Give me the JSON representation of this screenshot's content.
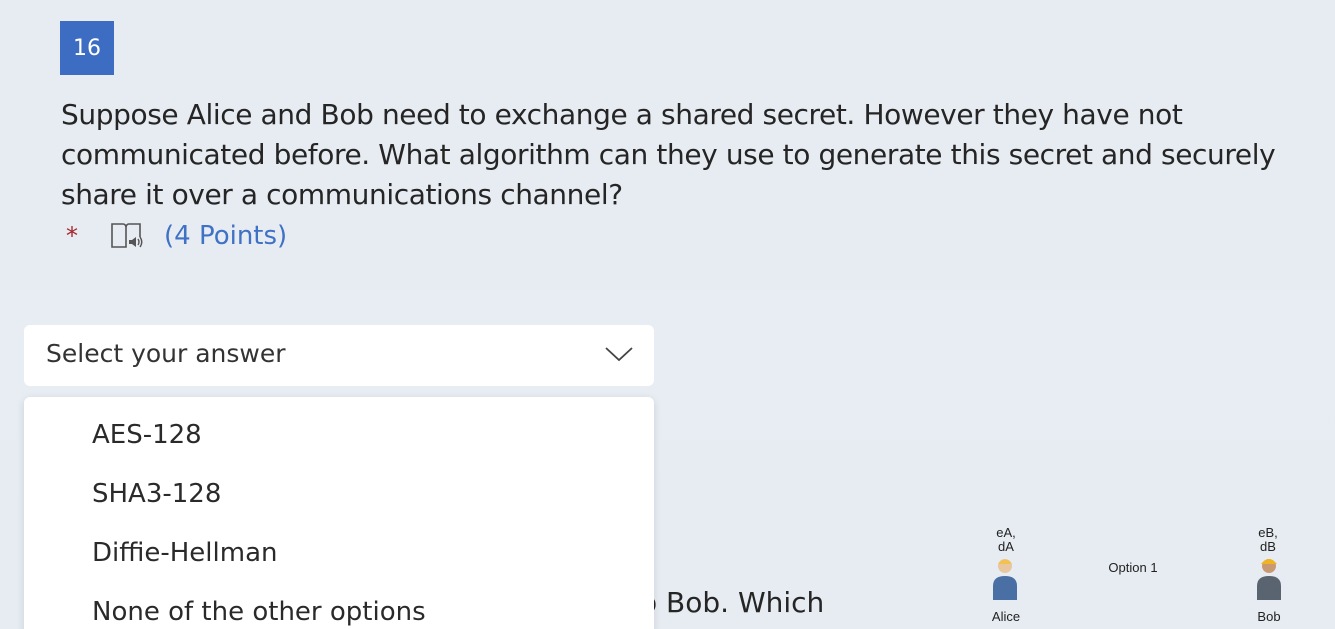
{
  "question": {
    "number": "16",
    "text": "Suppose Alice and Bob need to exchange a shared secret. However they have not communicated before. What algorithm can they use to generate this secret and securely share it over a communications channel?",
    "required_marker": "*",
    "points": "(4 Points)",
    "reader_icon": "immersive-reader-icon"
  },
  "answer_select": {
    "placeholder": "Select your answer",
    "expanded": true,
    "options": [
      "AES-128",
      "SHA3-128",
      "Diffie-Hellman",
      "None of the other options"
    ]
  },
  "next_question": {
    "partial_text": "o Bob. Which",
    "diagram": {
      "alice_keys_line1": "eA,",
      "alice_keys_line2": "dA",
      "bob_keys_line1": "eB,",
      "bob_keys_line2": "dB",
      "option_label": "Option 1",
      "alice_name": "Alice",
      "bob_name": "Bob"
    }
  },
  "colors": {
    "accent": "#3d6dc2",
    "points": "#3f72c5",
    "required": "#a4262c",
    "background": "#e7ecf2"
  }
}
